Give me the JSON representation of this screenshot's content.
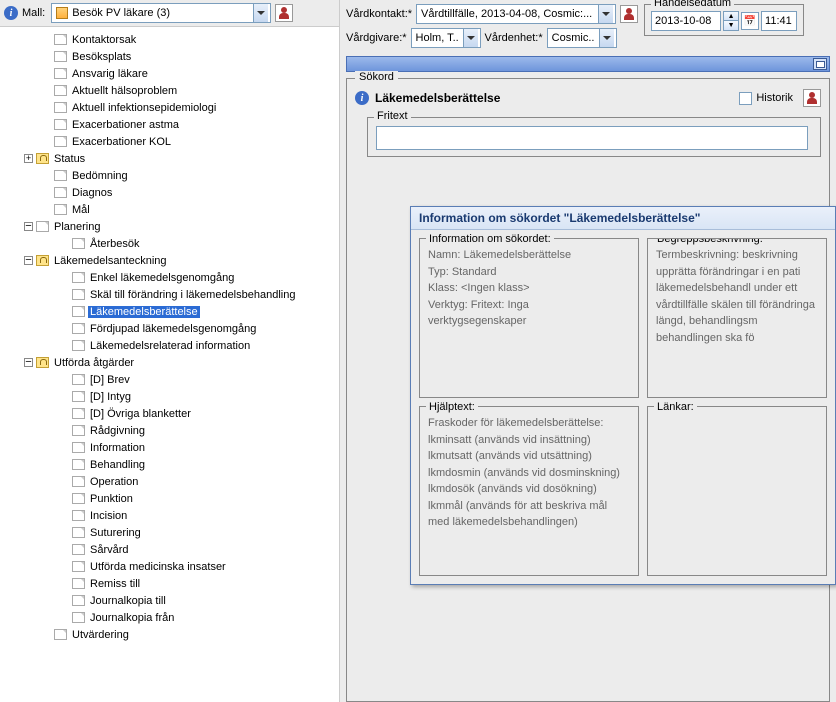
{
  "left": {
    "mall_label": "Mall:",
    "mall_value": "Besök PV läkare (3)",
    "tree": [
      {
        "d": 2,
        "t": "",
        "i": "doc",
        "label": "Kontaktorsak"
      },
      {
        "d": 2,
        "t": "",
        "i": "doc",
        "label": "Besöksplats"
      },
      {
        "d": 2,
        "t": "",
        "i": "doc",
        "label": "Ansvarig läkare"
      },
      {
        "d": 2,
        "t": "",
        "i": "doc",
        "label": "Aktuellt hälsoproblem"
      },
      {
        "d": 2,
        "t": "",
        "i": "doc",
        "label": "Aktuell infektionsepidemiologi"
      },
      {
        "d": 2,
        "t": "",
        "i": "doc",
        "label": "Exacerbationer astma"
      },
      {
        "d": 2,
        "t": "",
        "i": "doc",
        "label": "Exacerbationer KOL"
      },
      {
        "d": 1,
        "t": "plus",
        "i": "locked",
        "label": "Status"
      },
      {
        "d": 2,
        "t": "",
        "i": "doc",
        "label": "Bedömning"
      },
      {
        "d": 2,
        "t": "",
        "i": "doc",
        "label": "Diagnos"
      },
      {
        "d": 2,
        "t": "",
        "i": "doc",
        "label": "Mål"
      },
      {
        "d": 1,
        "t": "minus",
        "i": "doc",
        "label": "Planering"
      },
      {
        "d": 3,
        "t": "",
        "i": "doc",
        "label": "Återbesök"
      },
      {
        "d": 1,
        "t": "minus",
        "i": "locked",
        "label": "Läkemedelsanteckning"
      },
      {
        "d": 3,
        "t": "",
        "i": "doc",
        "label": "Enkel läkemedelsgenomgång"
      },
      {
        "d": 3,
        "t": "",
        "i": "doc",
        "label": "Skäl till förändring i läkemedelsbehandling"
      },
      {
        "d": 3,
        "t": "",
        "i": "doc",
        "label": "Läkemedelsberättelse",
        "selected": true
      },
      {
        "d": 3,
        "t": "",
        "i": "doc",
        "label": "Fördjupad läkemedelsgenomgång"
      },
      {
        "d": 3,
        "t": "",
        "i": "doc",
        "label": "Läkemedelsrelaterad information"
      },
      {
        "d": 1,
        "t": "minus",
        "i": "locked",
        "label": "Utförda åtgärder"
      },
      {
        "d": 3,
        "t": "",
        "i": "doc",
        "label": "[D] Brev"
      },
      {
        "d": 3,
        "t": "",
        "i": "doc",
        "label": "[D] Intyg"
      },
      {
        "d": 3,
        "t": "",
        "i": "doc",
        "label": "[D] Övriga blanketter"
      },
      {
        "d": 3,
        "t": "",
        "i": "doc",
        "label": "Rådgivning"
      },
      {
        "d": 3,
        "t": "",
        "i": "doc",
        "label": "Information"
      },
      {
        "d": 3,
        "t": "",
        "i": "doc",
        "label": "Behandling"
      },
      {
        "d": 3,
        "t": "",
        "i": "doc",
        "label": "Operation"
      },
      {
        "d": 3,
        "t": "",
        "i": "doc",
        "label": "Punktion"
      },
      {
        "d": 3,
        "t": "",
        "i": "doc",
        "label": "Incision"
      },
      {
        "d": 3,
        "t": "",
        "i": "doc",
        "label": "Suturering"
      },
      {
        "d": 3,
        "t": "",
        "i": "doc",
        "label": "Sårvård"
      },
      {
        "d": 3,
        "t": "",
        "i": "doc",
        "label": "Utförda medicinska insatser"
      },
      {
        "d": 3,
        "t": "",
        "i": "doc",
        "label": "Remiss till"
      },
      {
        "d": 3,
        "t": "",
        "i": "doc",
        "label": "Journalkopia till"
      },
      {
        "d": 3,
        "t": "",
        "i": "doc",
        "label": "Journalkopia från"
      },
      {
        "d": 2,
        "t": "",
        "i": "doc",
        "label": "Utvärdering"
      }
    ]
  },
  "right": {
    "vardkontakt_label": "Vårdkontakt:*",
    "vardkontakt_value": "Vårdtillfälle, 2013-04-08, Cosmic:...",
    "vardgivare_label": "Vårdgivare:*",
    "vardgivare_value": "Holm, T...",
    "vardenhet_label": "Vårdenhet:*",
    "vardenhet_value": "Cosmic...",
    "handelsedatum_label": "Händelsedatum",
    "date_value": "2013-10-08",
    "time_value": "11:41",
    "sokord_legend": "Sökord",
    "sokord_title": "Läkemedelsberättelse",
    "historik_label": "Historik",
    "fritext_legend": "Fritext"
  },
  "popup": {
    "title": "Information om sökordet \"Läkemedelsberättelse\"",
    "s1_legend": "Information om sökordet:",
    "s1_l1": "Namn: Läkemedelsberättelse",
    "s1_l2": "Typ: Standard",
    "s1_l3": "Klass: <Ingen klass>",
    "s1_l4": "Verktyg: Fritext: Inga verktygsegenskaper",
    "s2_legend": "Begreppsbeskrivning:",
    "s2_text": "Termbeskrivning: beskrivning upprätta förändringar i en pati läkemedelsbehandl under ett vårdtillfälle skälen till förändringa längd, behandlingsm behandlingen ska fö",
    "s3_legend": "Hjälptext:",
    "s3_l1": "Fraskoder för läkemedelsberättelse:",
    "s3_l2": "lkminsatt (används vid insättning)",
    "s3_l3": "lkmutsatt (används vid utsättning)",
    "s3_l4": "lkmdosmin (används vid dosminskning)",
    "s3_l5": "lkmdosök (används vid dosökning)",
    "s3_l6": "lkmmål (används för att beskriva mål med läkemedelsbehandlingen)",
    "s4_legend": "Länkar:"
  }
}
